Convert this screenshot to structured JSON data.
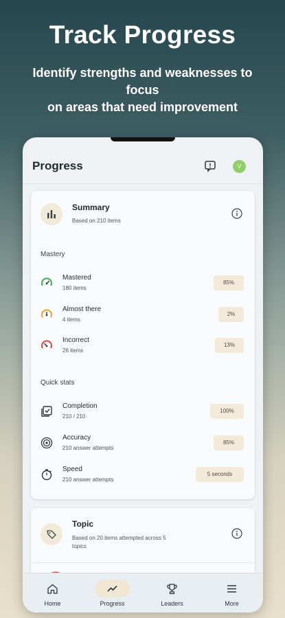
{
  "hero": {
    "title": "Track Progress",
    "subtitle_line1": "Identify strengths and weaknesses to",
    "subtitle_line2": "focus",
    "subtitle_line3": "on areas that need improvement"
  },
  "appbar": {
    "title": "Progress",
    "avatar_letter": "V",
    "icons": [
      "feedback-icon",
      "avatar"
    ]
  },
  "summary": {
    "title": "Summary",
    "subtitle": "Based on 210 items",
    "icon": "bar-chart-icon"
  },
  "mastery": {
    "label": "Mastery",
    "rows": [
      {
        "title": "Mastered",
        "sub": "180 items",
        "value": "85%",
        "icon": "gauge-green-icon"
      },
      {
        "title": "Almost there",
        "sub": "4 items",
        "value": "2%",
        "icon": "gauge-orange-icon"
      },
      {
        "title": "Incorrect",
        "sub": "26 items",
        "value": "13%",
        "icon": "gauge-red-icon"
      }
    ]
  },
  "quick_stats": {
    "label": "Quick stats",
    "rows": [
      {
        "title": "Completion",
        "sub": "210 / 210",
        "value": "100%",
        "icon": "checklist-icon"
      },
      {
        "title": "Accuracy",
        "sub": "210 answer attempts",
        "value": "85%",
        "icon": "target-icon"
      },
      {
        "title": "Speed",
        "sub": "210 answer attempts",
        "value": "5 seconds",
        "icon": "stopwatch-icon"
      }
    ]
  },
  "topic": {
    "title": "Topic",
    "subtitle_line1": "Based on 20 items attempted across 5",
    "subtitle_line2": "topics",
    "icon": "tag-icon"
  },
  "nav": {
    "items": [
      {
        "label": "Home",
        "icon": "home-icon"
      },
      {
        "label": "Progress",
        "icon": "trend-icon",
        "active": true
      },
      {
        "label": "Leaders",
        "icon": "trophy-icon"
      },
      {
        "label": "More",
        "icon": "menu-icon"
      }
    ]
  },
  "colors": {
    "accent_bg": "#f4ead9",
    "green": "#3fae5a",
    "orange": "#e8a33a",
    "red": "#d94b4b",
    "avatar": "#8fcf6a"
  }
}
